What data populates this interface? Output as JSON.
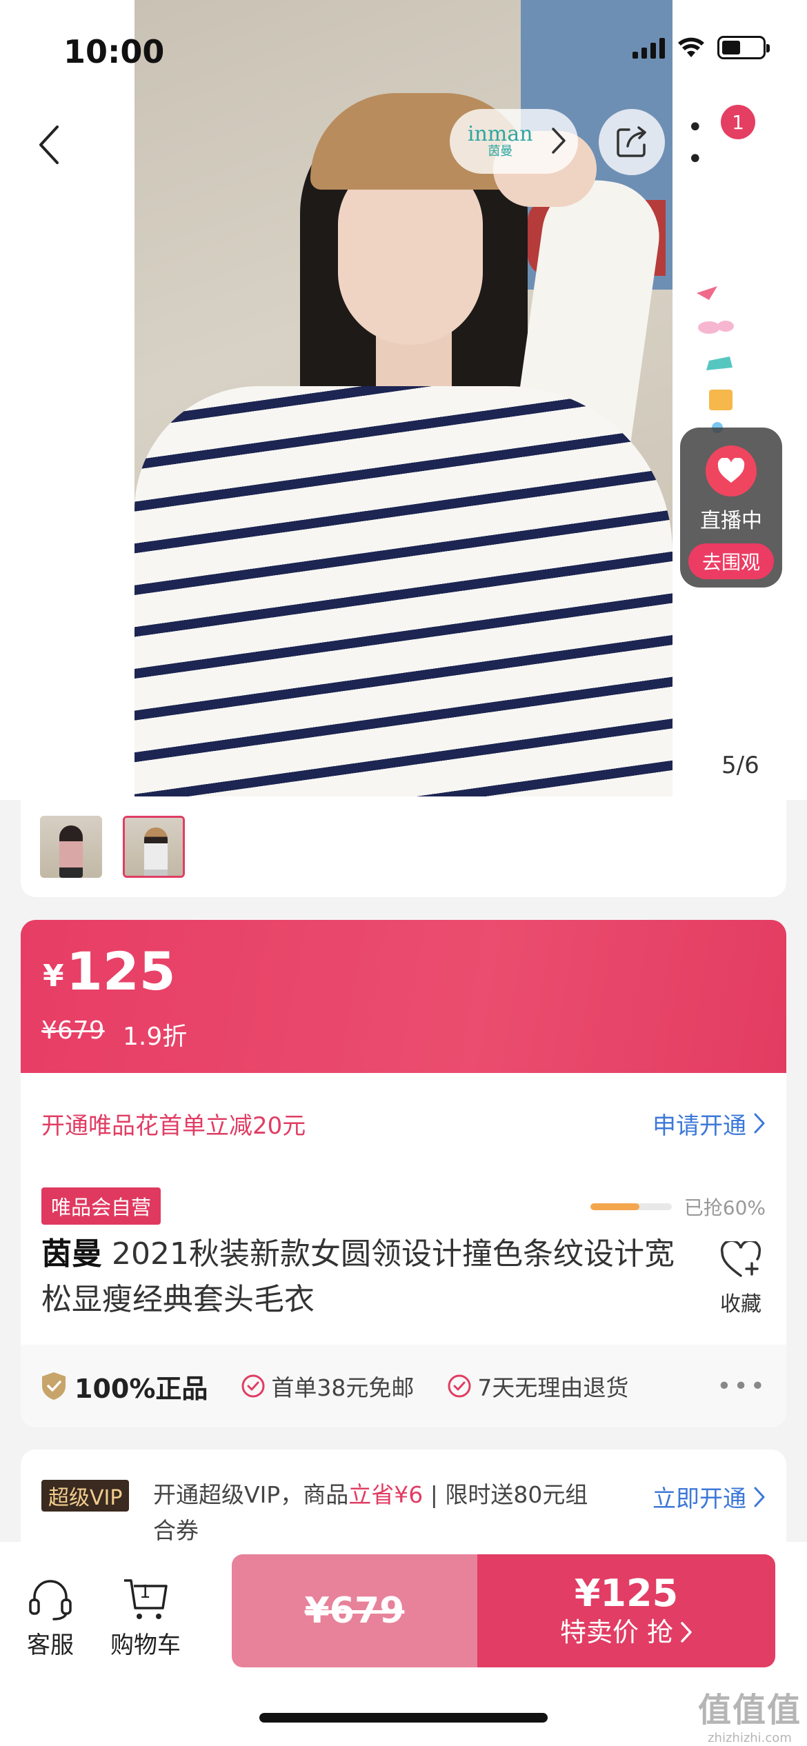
{
  "status_bar": {
    "time": "10:00"
  },
  "header": {
    "brand_logo_en": "inman",
    "brand_logo_cn": "茵曼",
    "more_badge": "1"
  },
  "live": {
    "label": "直播中",
    "button": "去围观"
  },
  "gallery": {
    "indicator": "5/6",
    "thumbnails": [
      "thumb-1",
      "thumb-2"
    ]
  },
  "price": {
    "currency": "¥",
    "current": "125",
    "original": "¥679",
    "discount": "1.9折"
  },
  "promo": {
    "text": "开通唯品花首单立减20元",
    "link": "申请开通"
  },
  "product": {
    "self_badge": "唯品会自营",
    "sold_progress": 0.6,
    "sold_label": "已抢60%",
    "brand": "茵曼",
    "title": "2021秋装新款女圆领设计撞色条纹设计宽松显瘦经典套头毛衣",
    "favorite_label": "收藏"
  },
  "assurance": {
    "main": "100%正品",
    "items": [
      "首单38元免邮",
      "7天无理由退货"
    ]
  },
  "vip": {
    "badge": "超级VIP",
    "text_a": "开通超级VIP，商品",
    "text_hl": "立省¥6",
    "text_b": "| 限时送80元组合券",
    "link": "立即开通"
  },
  "bottom": {
    "service_label": "客服",
    "cart_label": "购物车",
    "cart_count": "1",
    "original_price": "¥679",
    "buy_price": "¥125",
    "buy_label": "特卖价 抢"
  },
  "watermark": {
    "cn": "值值值",
    "en": "zhizhizhi.com"
  },
  "colors": {
    "accent": "#e23d64",
    "link": "#3d78d8",
    "progress": "#f3a64e"
  },
  "icons": [
    "back-icon",
    "chevron-right-icon",
    "share-icon",
    "more-icon",
    "heart-icon",
    "shield-icon",
    "check-circle-icon",
    "headset-icon",
    "cart-icon",
    "heart-plus-icon"
  ]
}
